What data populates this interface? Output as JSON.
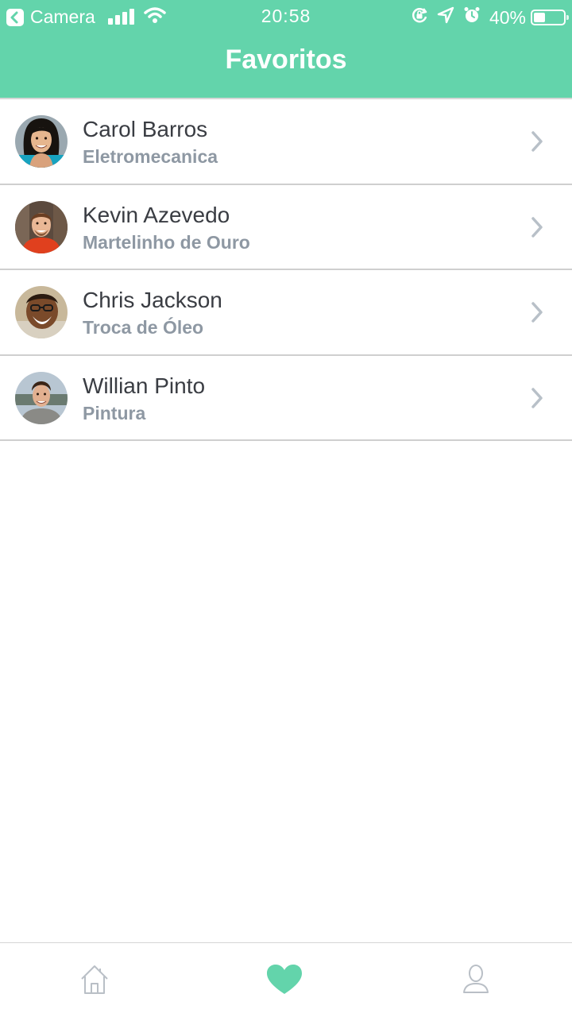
{
  "status_bar": {
    "back_app": "Camera",
    "time": "20:58",
    "battery": "40%",
    "battery_level": 0.4,
    "icons": [
      "back-arrow-icon",
      "signal-icon",
      "wifi-icon",
      "rotation-lock-icon",
      "location-icon",
      "alarm-icon",
      "battery-icon"
    ]
  },
  "header": {
    "title": "Favoritos",
    "color": "#63d4ab"
  },
  "favorites": [
    {
      "name": "Carol Barros",
      "service": "Eletromecanica"
    },
    {
      "name": "Kevin Azevedo",
      "service": "Martelinho de Ouro"
    },
    {
      "name": "Chris Jackson",
      "service": "Troca de Óleo"
    },
    {
      "name": "Willian Pinto",
      "service": "Pintura"
    }
  ],
  "tabbar": {
    "tabs": [
      {
        "icon": "home-icon",
        "active": false
      },
      {
        "icon": "heart-icon",
        "active": true
      },
      {
        "icon": "user-icon",
        "active": false
      }
    ],
    "active_color": "#63d4ab",
    "inactive_color": "#b9bfc6"
  }
}
